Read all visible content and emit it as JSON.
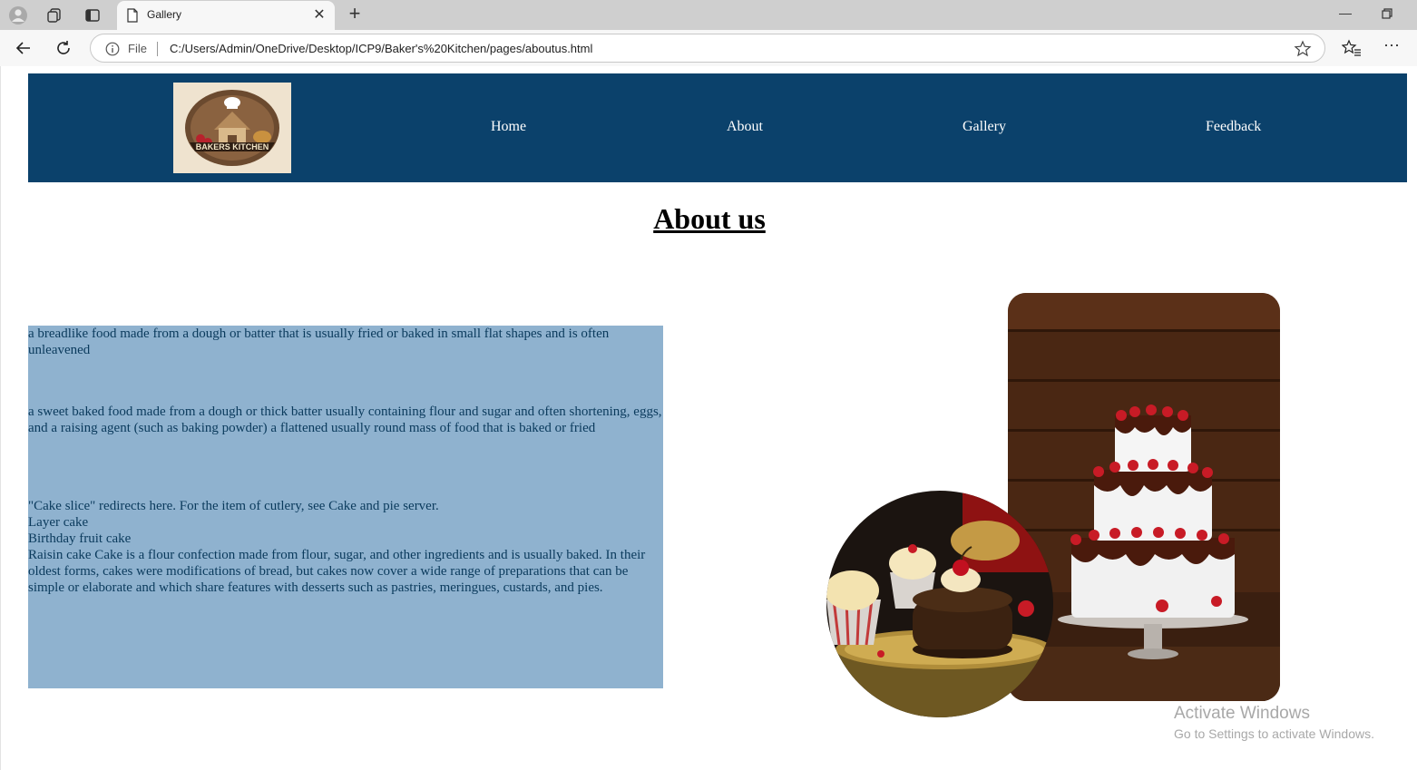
{
  "browser": {
    "tab_title": "Gallery",
    "address_prefix": "File",
    "url": "C:/Users/Admin/OneDrive/Desktop/ICP9/Baker's%20Kitchen/pages/aboutus.html"
  },
  "site": {
    "logo_text": "BAKERS KITCHEN",
    "nav": [
      "Home",
      "About",
      "Gallery",
      "Feedback"
    ],
    "nav_color": "#0b416b"
  },
  "page": {
    "title": "About us",
    "box_color": "#8fb2cf",
    "paragraph_1": "a breadlike food made from a dough or batter that is usually fried or baked in small flat shapes and is often unleavened",
    "paragraph_2": "a sweet baked food made from a dough or thick batter usually containing flour and sugar and often shortening, eggs, and a raising agent (such as baking powder) a flattened usually round mass of food that is baked or fried",
    "paragraph_3_line_1": "\"Cake slice\" redirects here. For the item of cutlery, see Cake and pie server.",
    "paragraph_3_line_2": "Layer cake",
    "paragraph_3_line_3": "Birthday fruit cake",
    "paragraph_3_line_4": "Raisin cake Cake is a flour confection made from flour, sugar, and other ingredients and is usually baked. In their oldest forms, cakes were modifications of bread, but cakes now cover a wide range of preparations that can be simple or elaborate and which share features with desserts such as pastries, meringues, custards, and pies."
  },
  "watermark": {
    "title": "Activate Windows",
    "subtitle": "Go to Settings to activate Windows."
  }
}
